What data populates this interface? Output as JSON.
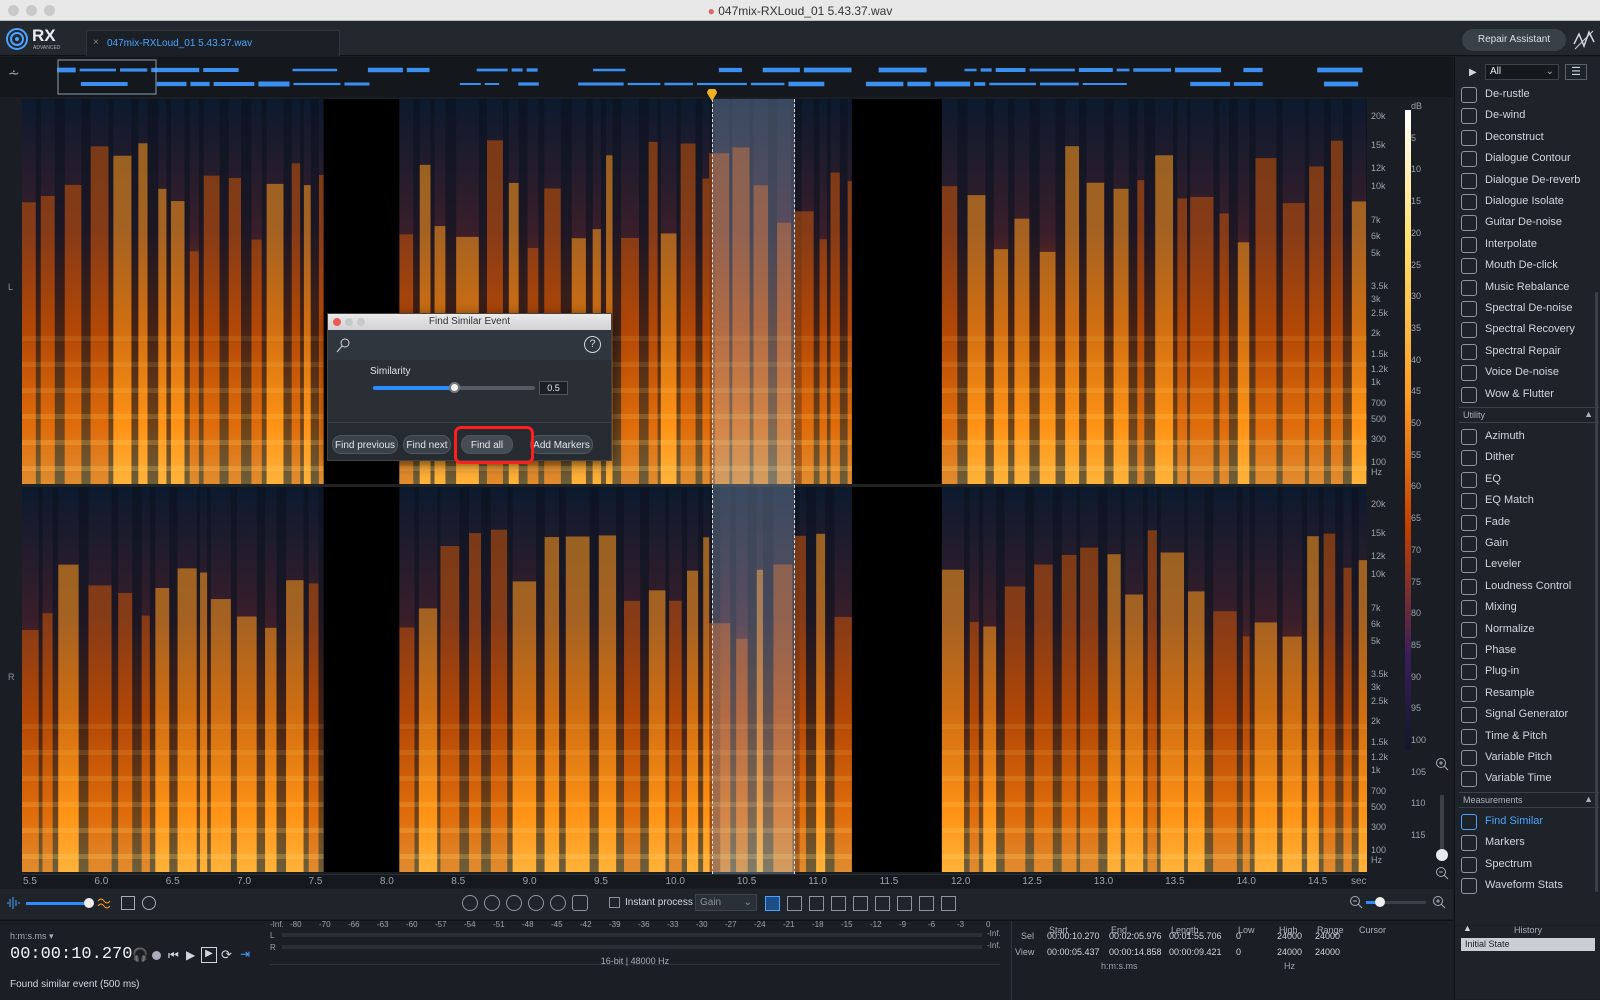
{
  "window": {
    "title": "047mix-RXLoud_01 5.43.37.wav"
  },
  "app": {
    "logo": "RX",
    "logo_sub": "ADVANCED",
    "tab_label": "047mix-RXLoud_01 5.43.37.wav",
    "repair_assistant": "Repair Assistant"
  },
  "spectrogram": {
    "channels": [
      "L",
      "R"
    ],
    "freq_labels": [
      "20k",
      "15k",
      "12k",
      "10k",
      "7k",
      "6k",
      "5k",
      "3.5k",
      "3k",
      "2.5k",
      "2k",
      "1.5k",
      "1.2k",
      "1k",
      "700",
      "500",
      "300",
      "100",
      "Hz"
    ],
    "db_labels": [
      "dB",
      "5",
      "10",
      "15",
      "20",
      "25",
      "30",
      "35",
      "40",
      "45",
      "50",
      "55",
      "60",
      "65",
      "70",
      "75",
      "80",
      "85",
      "90",
      "95",
      "100",
      "105",
      "110",
      "115"
    ],
    "time_labels": [
      "5.5",
      "6.0",
      "6.5",
      "7.0",
      "7.5",
      "8.0",
      "8.5",
      "9.0",
      "9.5",
      "10.0",
      "10.5",
      "11.0",
      "11.5",
      "12.0",
      "12.5",
      "13.0",
      "13.5",
      "14.0",
      "14.5",
      "sec"
    ],
    "view_start_sec": 5.437,
    "view_end_sec": 14.858,
    "selection_start_sec": 10.27,
    "selection_end_sec": 10.85,
    "colormap_accent": "#ff9a20"
  },
  "dialog": {
    "title": "Find Similar Event",
    "similarity_label": "Similarity",
    "similarity_value": "0.5",
    "similarity_fraction": 0.5,
    "buttons": {
      "prev": "Find previous",
      "next": "Find next",
      "all": "Find all",
      "markers": "Add Markers"
    },
    "help_icon": "question-icon",
    "tool_icon": "find-similar-icon"
  },
  "toolbar": {
    "instant_process": "Instant process",
    "gain_option": "Gain"
  },
  "transport": {
    "time_format": "h:m:s.ms",
    "time": "00:00:10.270",
    "status": "Found similar event (500 ms)"
  },
  "meter": {
    "scale": [
      "-Inf.",
      "-80",
      "-70",
      "-66",
      "-63",
      "-60",
      "-57",
      "-54",
      "-51",
      "-48",
      "-45",
      "-42",
      "-39",
      "-36",
      "-33",
      "-30",
      "-27",
      "-24",
      "-21",
      "-18",
      "-15",
      "-12",
      "-9",
      "-6",
      "-3",
      "0"
    ],
    "l": "L",
    "r": "R",
    "l_val": "-Inf.",
    "r_val": "-Inf.",
    "format": "16-bit | 48000 Hz"
  },
  "info": {
    "headers": [
      "Start",
      "End",
      "Length",
      "Low",
      "High",
      "Range",
      "Cursor"
    ],
    "sel_label": "Sel",
    "view_label": "View",
    "sel": [
      "00:00:10.270",
      "00:02:05.976",
      "00:01:55.706",
      "0",
      "24000",
      "24000"
    ],
    "view": [
      "00:00:05.437",
      "00:00:14.858",
      "00:00:09.421",
      "0",
      "24000",
      "24000"
    ],
    "time_unit": "h:m:s.ms",
    "hz_unit": "Hz"
  },
  "modules": {
    "filter": "All",
    "repair": [
      "De-rustle",
      "De-wind",
      "Deconstruct",
      "Dialogue Contour",
      "Dialogue De-reverb",
      "Dialogue Isolate",
      "Guitar De-noise",
      "Interpolate",
      "Mouth De-click",
      "Music Rebalance",
      "Spectral De-noise",
      "Spectral Recovery",
      "Spectral Repair",
      "Voice De-noise",
      "Wow & Flutter"
    ],
    "utility_label": "Utility",
    "utility": [
      "Azimuth",
      "Dither",
      "EQ",
      "EQ Match",
      "Fade",
      "Gain",
      "Leveler",
      "Loudness Control",
      "Mixing",
      "Normalize",
      "Phase",
      "Plug-in",
      "Resample",
      "Signal Generator",
      "Time & Pitch",
      "Variable Pitch",
      "Variable Time"
    ],
    "measurements_label": "Measurements",
    "measurements": [
      "Find Similar",
      "Markers",
      "Spectrum",
      "Waveform Stats"
    ],
    "active": "Find Similar",
    "active_color": "#4aa3ff"
  },
  "history": {
    "label": "History",
    "items": [
      "Initial State"
    ]
  }
}
